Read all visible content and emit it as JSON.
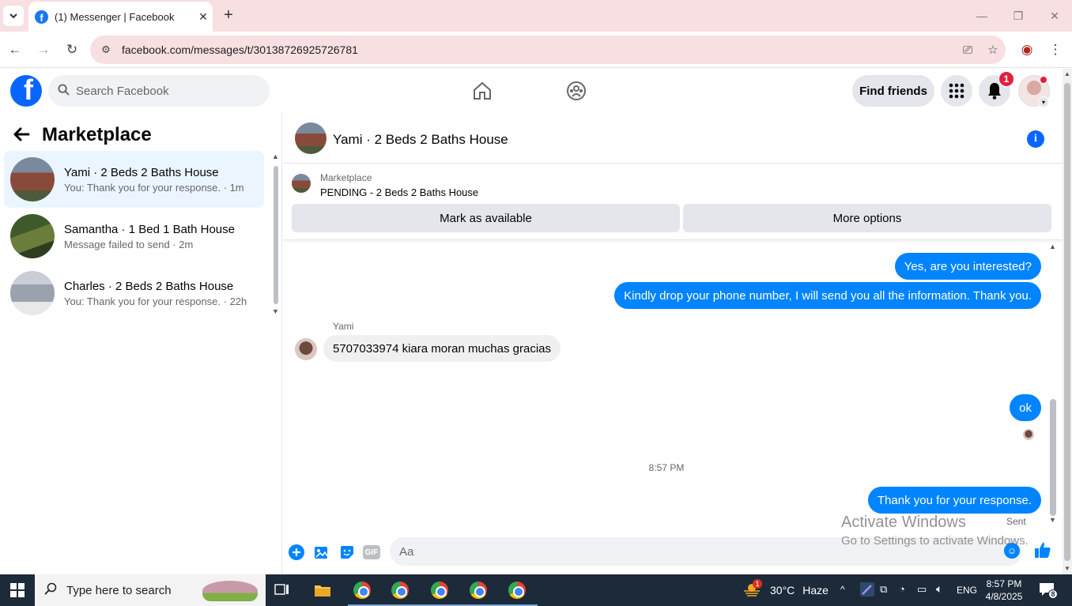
{
  "browser": {
    "tab_title": "(1) Messenger | Facebook",
    "url": "facebook.com/messages/t/30138726925726781"
  },
  "fb": {
    "search_placeholder": "Search Facebook",
    "find_friends": "Find friends",
    "notification_count": "1"
  },
  "sidebar": {
    "title": "Marketplace",
    "conversations": [
      {
        "name": "Yami · 2 Beds 2 Baths House",
        "snippet": "You: Thank you for your response. · 1m",
        "active": true
      },
      {
        "name": "Samantha · 1 Bed 1 Bath House",
        "snippet": "Message failed to send · 2m",
        "active": false
      },
      {
        "name": "Charles · 2 Beds 2 Baths House",
        "snippet": "You: Thank you for your response. · 22h",
        "active": false
      }
    ]
  },
  "chat": {
    "title": "Yami · 2 Beds 2 Baths House",
    "listing_label": "Marketplace",
    "listing_status": "PENDING - 2 Beds 2 Baths House",
    "mark_available": "Mark as available",
    "more_options": "More options",
    "messages": [
      {
        "from": "me",
        "text": "Yes, are you interested?"
      },
      {
        "from": "me",
        "text": "Kindly drop your phone number, I will send you all the information. Thank you."
      },
      {
        "from": "Yami",
        "text": "5707033974 kiara moran muchas gracias"
      },
      {
        "from": "me",
        "text": "ok"
      },
      {
        "from": "me",
        "text": "Thank you for your response."
      }
    ],
    "sender_name": "Yami",
    "timestamp": "8:57 PM",
    "sent_status": "Sent",
    "input_placeholder": "Aa",
    "gif_label": "GIF"
  },
  "watermark": {
    "line1": "Activate Windows",
    "line2": "Go to Settings to activate Windows."
  },
  "taskbar": {
    "search_placeholder": "Type here to search",
    "weather_temp": "30°C",
    "weather_desc": "Haze",
    "weather_badge": "1",
    "language": "ENG",
    "time": "8:57 PM",
    "date": "4/8/2025",
    "notif_count": "8"
  },
  "colors": {
    "fb_blue": "#0866ff",
    "bubble_blue": "#0084ff",
    "chrome_tint": "#f7dfe2"
  }
}
